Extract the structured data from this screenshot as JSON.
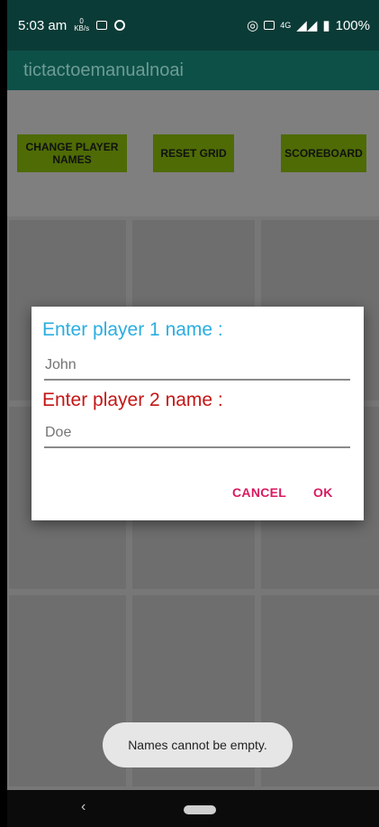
{
  "status_bar": {
    "time": "5:03 am",
    "net_speed_value": "0",
    "net_speed_unit": "KB/s",
    "battery": "100%",
    "network": "4G"
  },
  "app_bar": {
    "title": "tictactoemanualnoai"
  },
  "buttons": {
    "change_names": "CHANGE PLAYER NAMES",
    "reset_grid": "RESET GRID",
    "scoreboard": "SCOREBOARD"
  },
  "dialog": {
    "player1_label": "Enter player 1 name :",
    "player1_placeholder": "John",
    "player2_label": "Enter player 2 name :",
    "player2_placeholder": "Doe",
    "cancel_label": "CANCEL",
    "ok_label": "OK"
  },
  "toast": {
    "message": "Names cannot be empty."
  },
  "colors": {
    "accent": "#d81b60",
    "label1": "#2aaee0",
    "label2": "#c41616",
    "button_bg": "#4e6b05",
    "app_bar": "#0d5047"
  }
}
